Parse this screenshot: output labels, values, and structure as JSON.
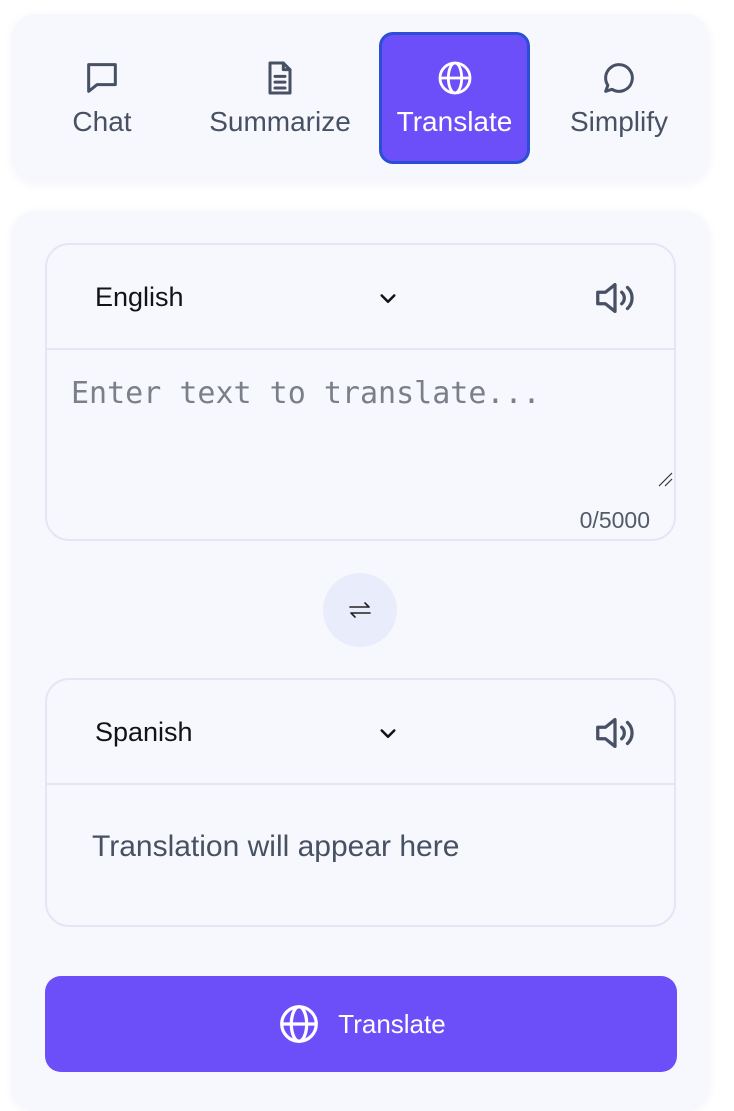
{
  "tabs": [
    {
      "label": "Chat",
      "icon": "chat-bubble-icon"
    },
    {
      "label": "Summarize",
      "icon": "document-icon"
    },
    {
      "label": "Translate",
      "icon": "globe-icon",
      "active": true
    },
    {
      "label": "Simplify",
      "icon": "speech-bubble-icon"
    }
  ],
  "source": {
    "language": "English",
    "placeholder": "Enter text to translate...",
    "value": "",
    "counter": "0/5000"
  },
  "target": {
    "language": "Spanish",
    "output_placeholder": "Translation will appear here"
  },
  "swap_symbol": "⇄",
  "translate_button_label": "Translate",
  "colors": {
    "accent": "#6c4ff9",
    "active_border": "#2a4fd4",
    "panel_bg": "#f7f8fd",
    "border": "#e3e6f4",
    "text": "#475163"
  }
}
